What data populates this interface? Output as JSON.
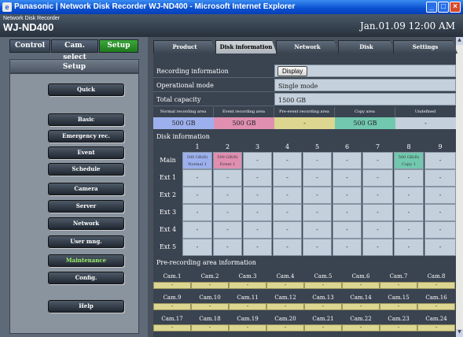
{
  "window": {
    "title": "Panasonic | Network Disk Recorder WJ-ND400 - Microsoft Internet Explorer"
  },
  "header": {
    "brand_small": "Network Disk Recorder",
    "brand_big": "WJ-ND400",
    "datetime": "Jan.01.09  12:00  AM"
  },
  "top_tabs": {
    "control": "Control",
    "cam_select": "Cam. select",
    "setup": "Setup"
  },
  "sidebar": {
    "title": "Setup",
    "items": [
      "Quick",
      "Basic",
      "Emergency rec.",
      "Event",
      "Schedule",
      "Camera",
      "Server",
      "Network",
      "User mng.",
      "Maintenance",
      "Config.",
      "Help"
    ],
    "active": "Maintenance"
  },
  "content_tabs": [
    "Product information",
    "Disk information",
    "Network information",
    "Disk",
    "Settings management"
  ],
  "active_tab": "Disk information",
  "info": {
    "recording_label": "Recording information",
    "display_button": "Display",
    "mode_label": "Operational mode",
    "mode_value": "Single mode",
    "capacity_label": "Total capacity",
    "capacity_value": "1500 GB"
  },
  "capacity": {
    "headers": [
      "Normal recording area",
      "Event recording area",
      "Pre-event recording area",
      "Copy area",
      "Undefined"
    ],
    "values": [
      "500 GB",
      "500 GB",
      "-",
      "500 GB",
      "-"
    ]
  },
  "disk_info": {
    "title": "Disk information",
    "columns": [
      "1",
      "2",
      "3",
      "4",
      "5",
      "6",
      "7",
      "8",
      "9"
    ],
    "rows": [
      {
        "label": "Main",
        "cells": [
          "500 GB(R)|Normal 1",
          "500 GB(R)|Event 1",
          "-",
          "-",
          "-",
          "-",
          "-",
          "500 GB(R)|Copy 1",
          "-"
        ]
      },
      {
        "label": "Ext 1",
        "cells": [
          "-",
          "-",
          "-",
          "-",
          "-",
          "-",
          "-",
          "-",
          "-"
        ]
      },
      {
        "label": "Ext 2",
        "cells": [
          "-",
          "-",
          "-",
          "-",
          "-",
          "-",
          "-",
          "-",
          "-"
        ]
      },
      {
        "label": "Ext 3",
        "cells": [
          "-",
          "-",
          "-",
          "-",
          "-",
          "-",
          "-",
          "-",
          "-"
        ]
      },
      {
        "label": "Ext 4",
        "cells": [
          "-",
          "-",
          "-",
          "-",
          "-",
          "-",
          "-",
          "-",
          "-"
        ]
      },
      {
        "label": "Ext 5",
        "cells": [
          "-",
          "-",
          "-",
          "-",
          "-",
          "-",
          "-",
          "-",
          "-"
        ]
      }
    ]
  },
  "prerec": {
    "title": "Pre-recording area information",
    "cams": [
      "Cam.1",
      "Cam.2",
      "Cam.3",
      "Cam.4",
      "Cam.5",
      "Cam.6",
      "Cam.7",
      "Cam.8",
      "Cam.9",
      "Cam.10",
      "Cam.11",
      "Cam.12",
      "Cam.13",
      "Cam.14",
      "Cam.15",
      "Cam.16",
      "Cam.17",
      "Cam.18",
      "Cam.19",
      "Cam.20",
      "Cam.21",
      "Cam.22",
      "Cam.23",
      "Cam.24"
    ],
    "values": [
      "-",
      "-",
      "-",
      "-",
      "-",
      "-",
      "-",
      "-",
      "-",
      "-",
      "-",
      "-",
      "-",
      "-",
      "-",
      "-",
      "-",
      "-",
      "-",
      "-",
      "-",
      "-",
      "-",
      "-"
    ]
  },
  "colors": {
    "normal": "#9db0ee",
    "event": "#e08fb0",
    "preevent": "#dcd690",
    "copy": "#72c8ae",
    "undefined": "#c4d0dc",
    "active_menu": "#9cf06a"
  }
}
